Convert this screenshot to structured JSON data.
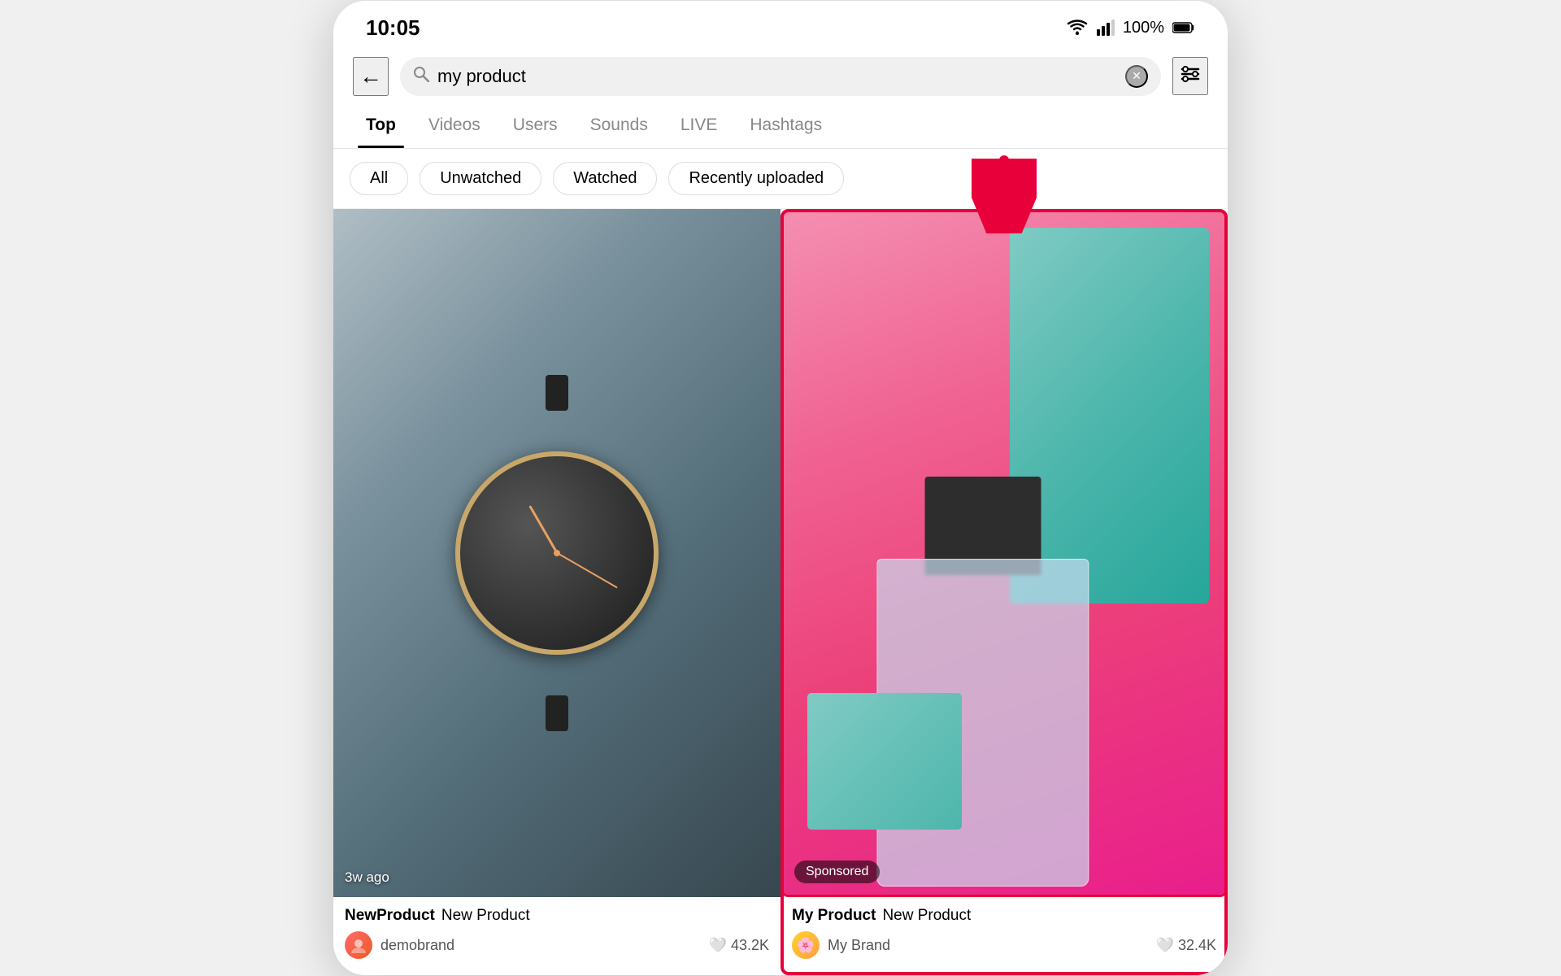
{
  "statusBar": {
    "time": "10:05",
    "batteryPercent": "100%",
    "wifiIcon": "wifi",
    "signalIcon": "signal",
    "batteryIcon": "battery"
  },
  "searchBar": {
    "query": "my product",
    "backIcon": "←",
    "searchIcon": "🔍",
    "clearIcon": "✕",
    "filterIcon": "⚙"
  },
  "tabs": [
    {
      "label": "Top",
      "active": true
    },
    {
      "label": "Videos",
      "active": false
    },
    {
      "label": "Users",
      "active": false
    },
    {
      "label": "Sounds",
      "active": false
    },
    {
      "label": "LIVE",
      "active": false
    },
    {
      "label": "Hashtags",
      "active": false
    }
  ],
  "filterPills": [
    {
      "label": "All",
      "active": false
    },
    {
      "label": "Unwatched",
      "active": false
    },
    {
      "label": "Watched",
      "active": false
    },
    {
      "label": "Recently uploaded",
      "active": false
    }
  ],
  "videos": [
    {
      "id": 1,
      "timestamp": "3w ago",
      "author": "NewProduct",
      "caption": "New Product",
      "brand": "demobrand",
      "likes": "43.2K",
      "highlighted": false,
      "sponsored": false
    },
    {
      "id": 2,
      "timestamp": "",
      "author": "My Product",
      "caption": "New Product",
      "brand": "My Brand",
      "likes": "32.4K",
      "highlighted": true,
      "sponsored": true,
      "sponsoredLabel": "Sponsored"
    }
  ],
  "annotation": {
    "arrowColor": "#e8003a"
  }
}
